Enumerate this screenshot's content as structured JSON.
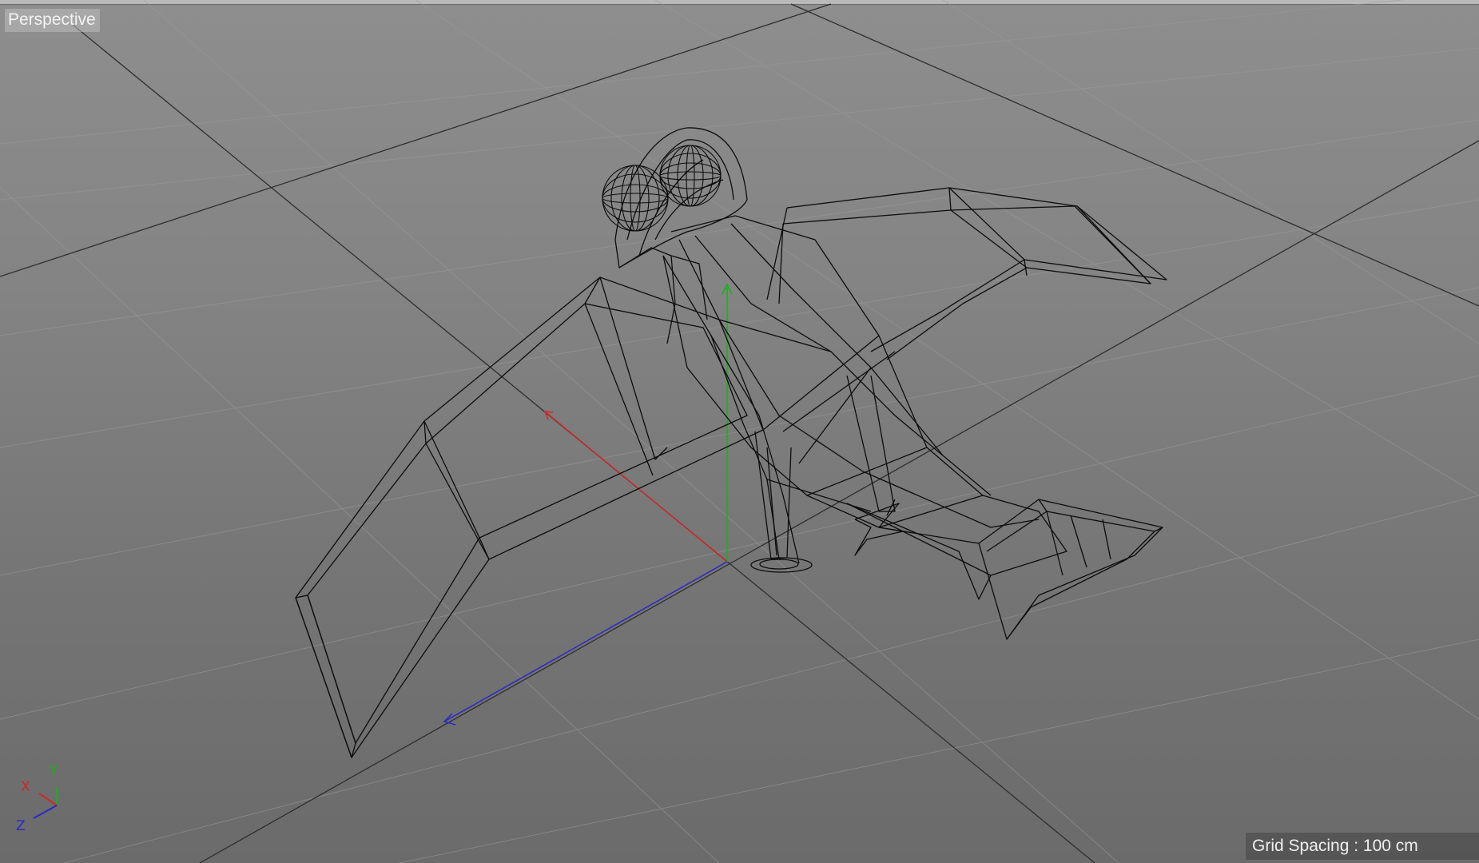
{
  "viewport": {
    "camera_label": "Perspective",
    "grid_spacing_label": "Grid Spacing : 100 cm"
  },
  "colors": {
    "axis_x": "#d02828",
    "axis_y": "#14b414",
    "axis_z": "#2828c8",
    "wireframe": "#0c0c0c"
  },
  "axis_gizmo": {
    "x_label": "X",
    "y_label": "Y",
    "z_label": "Z"
  },
  "objects": [
    {
      "name": "Bird",
      "display": "wireframe"
    }
  ]
}
